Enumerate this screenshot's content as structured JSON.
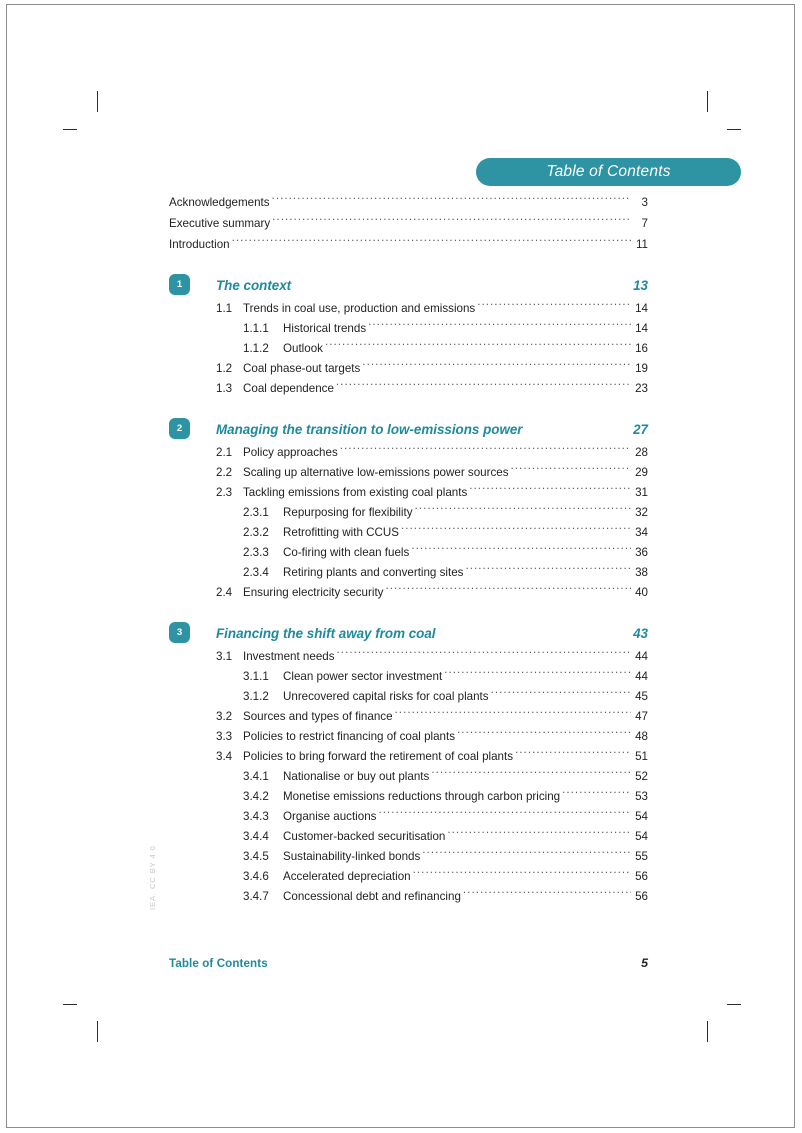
{
  "document": {
    "header_title": "Table of Contents",
    "accent_color": "#2e94a4",
    "title_color": "#1f8a9c",
    "text_color": "#231f20"
  },
  "front_matter": [
    {
      "label": "Acknowledgements",
      "page": "3"
    },
    {
      "label": "Executive summary",
      "page": "7"
    },
    {
      "label": "Introduction",
      "page": "11"
    }
  ],
  "chapters": [
    {
      "number": "1",
      "title": "The context",
      "page": "13",
      "entries": [
        {
          "level": 1,
          "num": "1.1",
          "label": "Trends in coal use, production and emissions",
          "page": "14"
        },
        {
          "level": 2,
          "num": "1.1.1",
          "label": "Historical trends",
          "page": "14"
        },
        {
          "level": 2,
          "num": "1.1.2",
          "label": "Outlook",
          "page": "16"
        },
        {
          "level": 1,
          "num": "1.2",
          "label": "Coal phase-out targets",
          "page": "19"
        },
        {
          "level": 1,
          "num": "1.3",
          "label": "Coal dependence",
          "page": "23"
        }
      ]
    },
    {
      "number": "2",
      "title": "Managing the transition to low-emissions power",
      "page": "27",
      "entries": [
        {
          "level": 1,
          "num": "2.1",
          "label": "Policy approaches",
          "page": "28"
        },
        {
          "level": 1,
          "num": "2.2",
          "label": "Scaling up alternative low-emissions power sources",
          "page": "29"
        },
        {
          "level": 1,
          "num": "2.3",
          "label": "Tackling emissions from existing coal plants",
          "page": "31"
        },
        {
          "level": 2,
          "num": "2.3.1",
          "label": "Repurposing for flexibility",
          "page": "32"
        },
        {
          "level": 2,
          "num": "2.3.2",
          "label": "Retrofitting with CCUS",
          "page": "34"
        },
        {
          "level": 2,
          "num": "2.3.3",
          "label": "Co-firing with clean fuels",
          "page": "36"
        },
        {
          "level": 2,
          "num": "2.3.4",
          "label": "Retiring plants and converting sites",
          "page": "38"
        },
        {
          "level": 1,
          "num": "2.4",
          "label": "Ensuring electricity security",
          "page": "40"
        }
      ]
    },
    {
      "number": "3",
      "title": "Financing the shift away from coal",
      "page": "43",
      "entries": [
        {
          "level": 1,
          "num": "3.1",
          "label": "Investment needs",
          "page": "44"
        },
        {
          "level": 2,
          "num": "3.1.1",
          "label": "Clean power sector investment",
          "page": "44"
        },
        {
          "level": 2,
          "num": "3.1.2",
          "label": "Unrecovered capital risks for coal plants",
          "page": "45"
        },
        {
          "level": 1,
          "num": "3.2",
          "label": "Sources and types of finance",
          "page": "47"
        },
        {
          "level": 1,
          "num": "3.3",
          "label": "Policies to restrict financing of coal plants",
          "page": "48"
        },
        {
          "level": 1,
          "num": "3.4",
          "label": "Policies to bring forward the retirement of coal plants",
          "page": "51"
        },
        {
          "level": 2,
          "num": "3.4.1",
          "label": "Nationalise or buy out plants",
          "page": "52"
        },
        {
          "level": 2,
          "num": "3.4.2",
          "label": "Monetise emissions reductions through carbon pricing",
          "page": "53"
        },
        {
          "level": 2,
          "num": "3.4.3",
          "label": "Organise auctions",
          "page": "54"
        },
        {
          "level": 2,
          "num": "3.4.4",
          "label": "Customer-backed securitisation",
          "page": "54"
        },
        {
          "level": 2,
          "num": "3.4.5",
          "label": "Sustainability-linked bonds",
          "page": "55"
        },
        {
          "level": 2,
          "num": "3.4.6",
          "label": "Accelerated depreciation",
          "page": "56"
        },
        {
          "level": 2,
          "num": "3.4.7",
          "label": "Concessional debt and refinancing",
          "page": "56"
        }
      ]
    }
  ],
  "footer": {
    "label": "Table of Contents",
    "page": "5"
  },
  "rights_notice": "IEA. CC BY 4.0"
}
